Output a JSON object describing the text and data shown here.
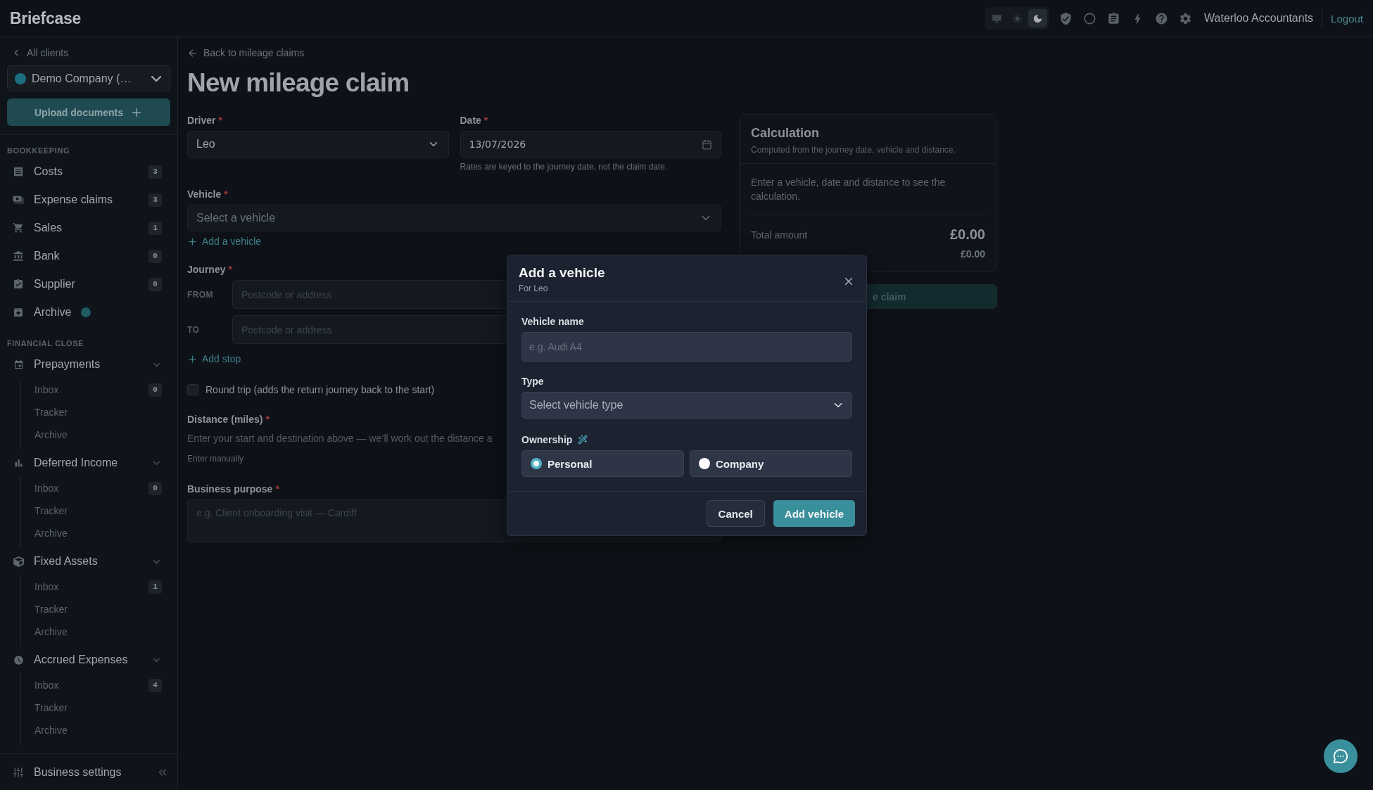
{
  "app": {
    "logo": "Briefcase",
    "theme_options": [
      {
        "selected": false
      },
      {
        "selected": false
      },
      {
        "selected": true
      }
    ],
    "account": "Waterloo Accountants",
    "logout": "Logout"
  },
  "sidebar": {
    "back": "All clients",
    "company": "Demo Company (…",
    "upload": "Upload documents",
    "bookkeeping": {
      "title": "BOOKKEEPING",
      "items": [
        {
          "label": "Costs",
          "badge": "3",
          "dot": false
        },
        {
          "label": "Expense claims",
          "badge": "3",
          "dot": false
        },
        {
          "label": "Sales",
          "badge": "1",
          "dot": false
        },
        {
          "label": "Bank",
          "badge": "0",
          "dot": false
        },
        {
          "label": "Supplier",
          "badge": "0",
          "dot": false
        },
        {
          "label": "Archive",
          "dot": true
        }
      ]
    },
    "financial_close": {
      "title": "FINANCIAL CLOSE",
      "groups": [
        {
          "label": "Prepayments",
          "expanded": true,
          "children": [
            {
              "label": "Inbox",
              "badge": "0"
            },
            {
              "label": "Tracker"
            },
            {
              "label": "Archive"
            }
          ]
        },
        {
          "label": "Deferred Income",
          "expanded": true,
          "children": [
            {
              "label": "Inbox",
              "badge": "0"
            },
            {
              "label": "Tracker"
            },
            {
              "label": "Archive"
            }
          ]
        },
        {
          "label": "Fixed Assets",
          "expanded": true,
          "children": [
            {
              "label": "Inbox",
              "badge": "1"
            },
            {
              "label": "Tracker"
            },
            {
              "label": "Archive"
            }
          ]
        },
        {
          "label": "Accrued Expenses",
          "expanded": true,
          "children": [
            {
              "label": "Inbox",
              "badge": "4"
            },
            {
              "label": "Tracker"
            },
            {
              "label": "Archive"
            }
          ]
        }
      ]
    },
    "footer": "Business settings"
  },
  "page": {
    "back": "Back to mileage claims",
    "title": "New mileage claim",
    "required_mark": "*",
    "driver": {
      "label": "Driver",
      "required": true,
      "value": "Leo"
    },
    "date": {
      "label": "Date",
      "required": true,
      "value": "13/07/2026",
      "hint": "Rates are keyed to the journey date, not the claim date."
    },
    "vehicle": {
      "label": "Vehicle",
      "required": true,
      "placeholder": "Select a vehicle",
      "add_link": "Add a vehicle"
    },
    "journey": {
      "label": "Journey",
      "required": true,
      "stops": [
        {
          "label": "FROM",
          "placeholder": "Postcode or address"
        },
        {
          "label": "TO",
          "placeholder": "Postcode or address"
        }
      ],
      "add_link": "Add stop"
    },
    "round_trip": {
      "label": "Round trip (adds the return journey back to the start)",
      "checked": false
    },
    "distance": {
      "label": "Distance (miles)",
      "required": true,
      "helper": "Enter your start and destination above — we’ll work out the distance a",
      "manual_link": "Enter manually"
    },
    "purpose": {
      "label": "Business purpose",
      "required": true,
      "placeholder": "e.g. Client onboarding visit — Cardiff"
    }
  },
  "calculation": {
    "title": "Calculation",
    "subtitle": "Computed from the journey date, vehicle and distance.",
    "message": "Enter a vehicle, date and distance to see the calculation.",
    "total_label": "Total amount",
    "total": "£0.00",
    "row_2_value": "£0.00",
    "submit": "e claim"
  },
  "dialog": {
    "title": "Add a vehicle",
    "subtitle": "For Leo",
    "name": {
      "label": "Vehicle name",
      "placeholder": "e.g. Audi A4"
    },
    "type": {
      "label": "Type",
      "placeholder": "Select vehicle type"
    },
    "ownership": {
      "label": "Ownership",
      "options": [
        {
          "label": "Personal",
          "selected": true
        },
        {
          "label": "Company",
          "selected": false
        }
      ]
    },
    "buttons": [
      {
        "label": "Cancel",
        "kind": "secondary"
      },
      {
        "label": "Add vehicle",
        "kind": "primary"
      }
    ]
  }
}
